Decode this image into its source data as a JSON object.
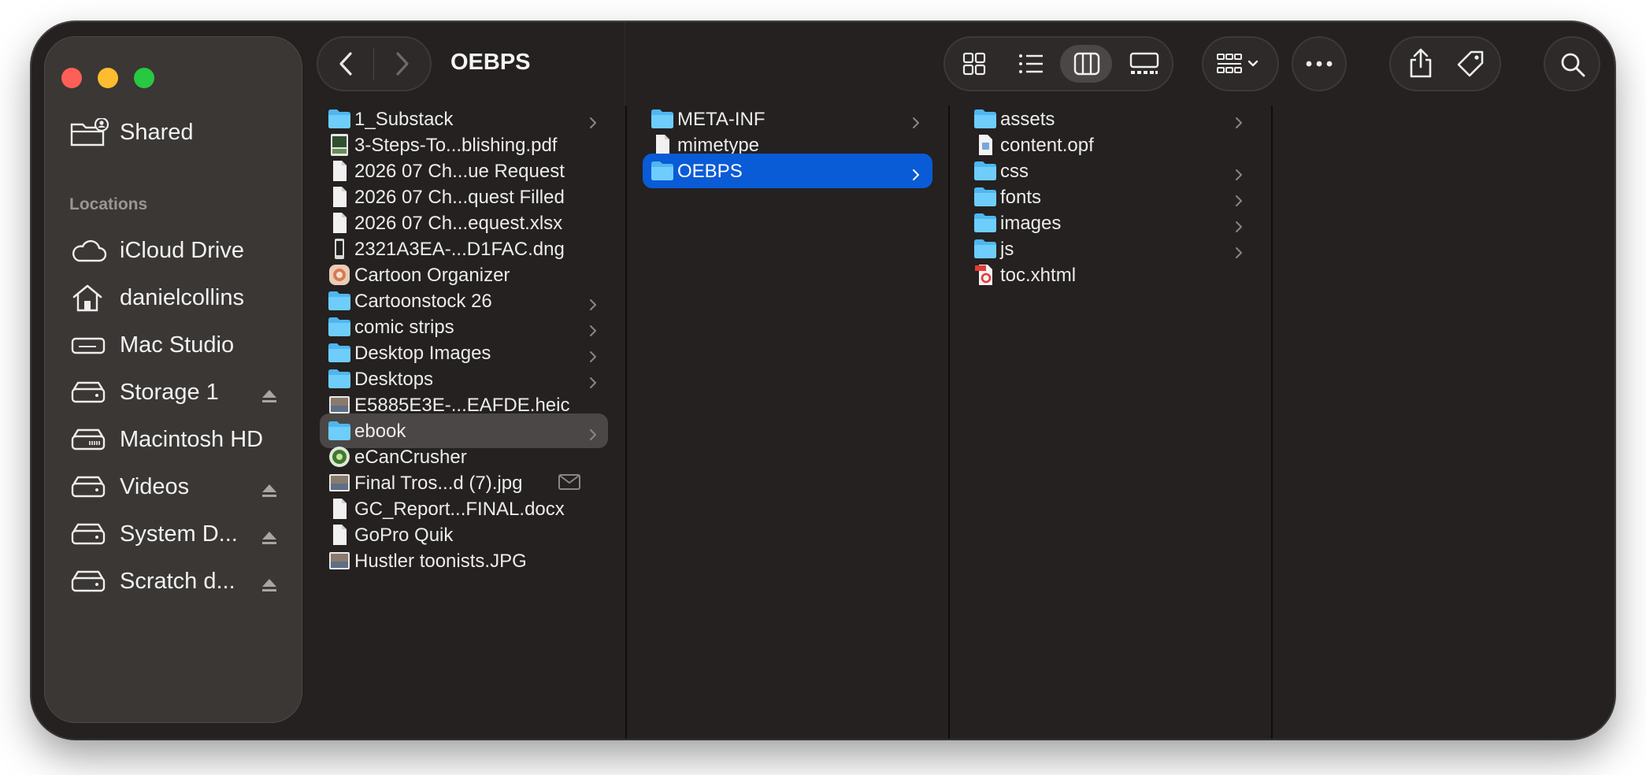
{
  "window": {
    "title": "OEBPS"
  },
  "sidebar": {
    "shared_label": "Shared",
    "locations_heading": "Locations",
    "items": [
      {
        "label": "iCloud Drive",
        "icon": "cloud-icon",
        "eject": false
      },
      {
        "label": "danielcollins",
        "icon": "home-icon",
        "eject": false
      },
      {
        "label": "Mac Studio",
        "icon": "computer-icon",
        "eject": false
      },
      {
        "label": "Storage 1",
        "icon": "drive-icon",
        "eject": true
      },
      {
        "label": "Macintosh HD",
        "icon": "internal-drive-icon",
        "eject": false
      },
      {
        "label": "Videos",
        "icon": "drive-icon",
        "eject": true
      },
      {
        "label": "System D...",
        "icon": "drive-icon",
        "eject": true
      },
      {
        "label": "Scratch d...",
        "icon": "drive-icon",
        "eject": true
      }
    ]
  },
  "toolbar": {
    "back": "chevron-left-icon",
    "forward": "chevron-right-icon",
    "views": [
      "icon-view-icon",
      "list-view-icon",
      "column-view-icon",
      "gallery-view-icon"
    ],
    "active_view": "column-view-icon",
    "group": "group-by-icon",
    "more": "more-icon",
    "share": "share-icon",
    "tag": "tag-icon",
    "search": "search-icon"
  },
  "columns": {
    "col1": [
      {
        "name": "1_Substack",
        "kind": "folder",
        "chevron": true
      },
      {
        "name": "3-Steps-To...blishing.pdf",
        "kind": "pdf",
        "chevron": false
      },
      {
        "name": "2026 07 Ch...ue Request",
        "kind": "doc",
        "chevron": false
      },
      {
        "name": "2026 07 Ch...quest Filled",
        "kind": "doc",
        "chevron": false
      },
      {
        "name": "2026 07 Ch...equest.xlsx",
        "kind": "doc",
        "chevron": false
      },
      {
        "name": "2321A3EA-...D1FAC.dng",
        "kind": "photo-dark",
        "chevron": false
      },
      {
        "name": "Cartoon Organizer",
        "kind": "app",
        "chevron": false
      },
      {
        "name": "Cartoonstock 26",
        "kind": "folder",
        "chevron": true
      },
      {
        "name": "comic strips",
        "kind": "folder",
        "chevron": true
      },
      {
        "name": "Desktop Images",
        "kind": "folder",
        "chevron": true
      },
      {
        "name": "Desktops",
        "kind": "folder",
        "chevron": true
      },
      {
        "name": "E5885E3E-...EAFDE.heic",
        "kind": "photo",
        "chevron": false
      },
      {
        "name": "ebook",
        "kind": "folder",
        "chevron": true,
        "selected": "grey"
      },
      {
        "name": "eCanCrusher",
        "kind": "app-green",
        "chevron": false
      },
      {
        "name": "Final Tros...d (7).jpg",
        "kind": "photo",
        "chevron": false,
        "mail_icon": true
      },
      {
        "name": "GC_Report...FINAL.docx",
        "kind": "doc",
        "chevron": false
      },
      {
        "name": "GoPro Quik",
        "kind": "doc",
        "chevron": false
      },
      {
        "name": "Hustler toonists.JPG",
        "kind": "photo",
        "chevron": false
      }
    ],
    "col2": [
      {
        "name": "META-INF",
        "kind": "folder",
        "chevron": true
      },
      {
        "name": "mimetype",
        "kind": "doc",
        "chevron": false
      },
      {
        "name": "OEBPS",
        "kind": "folder",
        "chevron": true,
        "selected": "blue"
      }
    ],
    "col3": [
      {
        "name": "assets",
        "kind": "folder",
        "chevron": true
      },
      {
        "name": "content.opf",
        "kind": "opf",
        "chevron": false
      },
      {
        "name": "css",
        "kind": "folder",
        "chevron": true
      },
      {
        "name": "fonts",
        "kind": "folder",
        "chevron": true
      },
      {
        "name": "images",
        "kind": "folder",
        "chevron": true
      },
      {
        "name": "js",
        "kind": "folder",
        "chevron": true
      },
      {
        "name": "toc.xhtml",
        "kind": "xhtml",
        "chevron": false
      }
    ]
  },
  "colors": {
    "window_bg": "#242120",
    "sidebar_bg": "#3a3735",
    "selection_blue": "#0a5bd6",
    "selection_grey": "#4a4746",
    "folder_blue": "#5ec3f5"
  }
}
